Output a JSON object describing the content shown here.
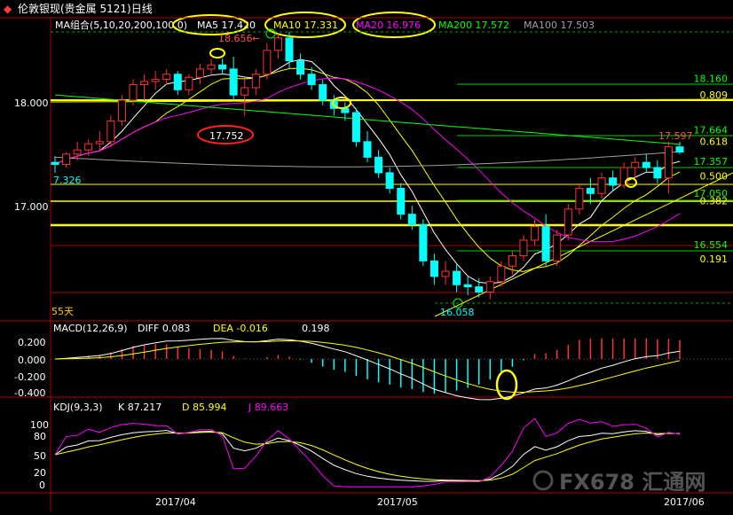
{
  "title": "伦敦银现(贵金属 5121)日线",
  "ma_header": {
    "label": "MA组合(5,10,20,200,100,0)",
    "ma5": "MA5 17.420",
    "ma10": "MA10 17.331",
    "ma20": "MA20 16.976",
    "ma200": "MA200 17.572",
    "ma100": "MA100 17.503"
  },
  "macd_header": {
    "label": "MACD(12,26,9)",
    "diff": "DIFF  0.083",
    "dea": "DEA  -0.016",
    "macd": "0.198"
  },
  "kdj_header": {
    "label": "KDJ(9,3,3)",
    "k": "K  87.217",
    "d": "D  85.994",
    "j": "J  89.663"
  },
  "annotations": {
    "high": "18.656",
    "low_box": "17.752",
    "start": "7.326",
    "bottom": "16.058",
    "last": "17.597",
    "days": "55天"
  },
  "watermark": "FX678 汇通网",
  "colors": {
    "up": "#ff3232",
    "down": "#00ffff",
    "ma5": "#ffffff",
    "ma10": "#ffff00",
    "ma20": "#ff00ff",
    "ma200": "#00ff00",
    "ma100": "#a0a0a0",
    "fib": "#ffff00",
    "grid": "#b00000",
    "highlight": "#ffff00"
  },
  "chart_data": [
    {
      "type": "candlestick",
      "title": "伦敦银现(贵金属 5121)日线",
      "y_ticks": [
        "18.000",
        "17.000"
      ],
      "x_ticks": [
        "2017/04",
        "2017/05",
        "2017/06"
      ],
      "ylim": [
        16.0,
        18.75
      ],
      "candles": [
        [
          17.4,
          17.46,
          17.3,
          17.38
        ],
        [
          17.38,
          17.5,
          17.35,
          17.48
        ],
        [
          17.48,
          17.6,
          17.42,
          17.52
        ],
        [
          17.52,
          17.62,
          17.46,
          17.58
        ],
        [
          17.58,
          17.7,
          17.52,
          17.6
        ],
        [
          17.6,
          17.85,
          17.55,
          17.8
        ],
        [
          17.8,
          18.05,
          17.75,
          18.0
        ],
        [
          18.0,
          18.2,
          17.95,
          18.15
        ],
        [
          18.15,
          18.25,
          18.0,
          18.18
        ],
        [
          18.18,
          18.28,
          18.1,
          18.2
        ],
        [
          18.2,
          18.3,
          18.15,
          18.25
        ],
        [
          18.25,
          18.28,
          18.05,
          18.1
        ],
        [
          18.1,
          18.25,
          18.05,
          18.22
        ],
        [
          18.22,
          18.35,
          18.15,
          18.3
        ],
        [
          18.3,
          18.4,
          18.25,
          18.34
        ],
        [
          18.34,
          18.4,
          18.25,
          18.3
        ],
        [
          18.3,
          18.42,
          18.0,
          18.05
        ],
        [
          18.05,
          18.2,
          17.85,
          18.12
        ],
        [
          18.12,
          18.3,
          18.05,
          18.25
        ],
        [
          18.25,
          18.55,
          18.2,
          18.48
        ],
        [
          18.48,
          18.65,
          18.4,
          18.6
        ],
        [
          18.6,
          18.66,
          18.3,
          18.38
        ],
        [
          18.38,
          18.45,
          18.2,
          18.25
        ],
        [
          18.25,
          18.32,
          18.1,
          18.15
        ],
        [
          18.15,
          18.2,
          17.95,
          18.0
        ],
        [
          18.0,
          18.05,
          17.85,
          17.92
        ],
        [
          17.92,
          17.98,
          17.8,
          17.88
        ],
        [
          17.88,
          17.92,
          17.55,
          17.6
        ],
        [
          17.6,
          17.7,
          17.4,
          17.45
        ],
        [
          17.45,
          17.52,
          17.25,
          17.3
        ],
        [
          17.3,
          17.35,
          17.1,
          17.15
        ],
        [
          17.15,
          17.2,
          16.85,
          16.9
        ],
        [
          16.9,
          16.98,
          16.75,
          16.8
        ],
        [
          16.8,
          16.85,
          16.4,
          16.45
        ],
        [
          16.45,
          16.52,
          16.22,
          16.3
        ],
        [
          16.3,
          16.45,
          16.22,
          16.35
        ],
        [
          16.35,
          16.42,
          16.15,
          16.22
        ],
        [
          16.22,
          16.3,
          16.12,
          16.2
        ],
        [
          16.2,
          16.28,
          16.1,
          16.15
        ],
        [
          16.15,
          16.3,
          16.08,
          16.25
        ],
        [
          16.25,
          16.45,
          16.2,
          16.4
        ],
        [
          16.4,
          16.55,
          16.32,
          16.5
        ],
        [
          16.5,
          16.7,
          16.45,
          16.65
        ],
        [
          16.65,
          16.85,
          16.6,
          16.78
        ],
        [
          16.78,
          16.9,
          16.4,
          16.45
        ],
        [
          16.45,
          16.75,
          16.4,
          16.7
        ],
        [
          16.7,
          17.0,
          16.65,
          16.95
        ],
        [
          16.95,
          17.2,
          16.9,
          17.15
        ],
        [
          17.15,
          17.25,
          17.0,
          17.1
        ],
        [
          17.1,
          17.3,
          17.05,
          17.25
        ],
        [
          17.25,
          17.32,
          17.12,
          17.18
        ],
        [
          17.18,
          17.4,
          17.15,
          17.35
        ],
        [
          17.35,
          17.45,
          17.25,
          17.4
        ],
        [
          17.4,
          17.48,
          17.3,
          17.35
        ],
        [
          17.35,
          17.42,
          17.2,
          17.25
        ],
        [
          17.25,
          17.6,
          17.1,
          17.55
        ],
        [
          17.55,
          17.6,
          17.48,
          17.5
        ]
      ],
      "horizontal_levels": [
        {
          "label": "18.160",
          "value": 18.16,
          "color": "#00ff00"
        },
        {
          "label": "0.809",
          "value": 18.0,
          "color": "#ffff00"
        },
        {
          "label": "17.664",
          "value": 17.664,
          "color": "#00ff00"
        },
        {
          "label": "0.618",
          "value": 17.55,
          "color": "#ffff00"
        },
        {
          "label": "17.357",
          "value": 17.357,
          "color": "#00ff00"
        },
        {
          "label": "0.500",
          "value": 17.22,
          "color": "#ffff00"
        },
        {
          "label": "17.050",
          "value": 17.05,
          "color": "#00ff00"
        },
        {
          "label": "0.382",
          "value": 16.98,
          "color": "#ffff00"
        },
        {
          "label": "16.554",
          "value": 16.554,
          "color": "#00ff00"
        },
        {
          "label": "0.191",
          "value": 16.42,
          "color": "#ffff00"
        }
      ]
    },
    {
      "type": "bar",
      "title": "MACD(12,26,9)",
      "y_ticks": [
        "0.200",
        "0.000",
        "-0.200",
        "-0.400"
      ],
      "ylim": [
        -0.48,
        0.26
      ]
    },
    {
      "type": "line",
      "title": "KDJ(9,3,3)",
      "y_ticks": [
        "100",
        "80",
        "50",
        "20",
        "0"
      ],
      "ylim": [
        -5,
        115
      ]
    }
  ]
}
